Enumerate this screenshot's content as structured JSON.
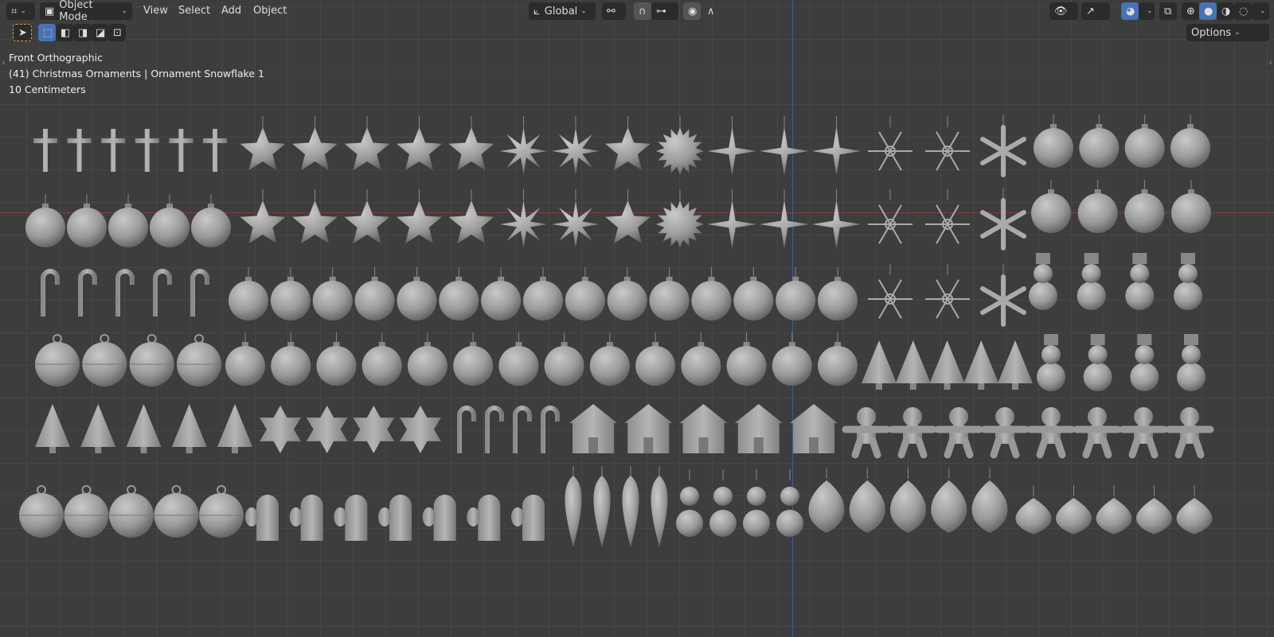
{
  "header": {
    "editor_type": "3D Viewport",
    "mode": "Object Mode",
    "menus": [
      "View",
      "Select",
      "Add",
      "Object"
    ],
    "orientation": "Global",
    "options": "Options"
  },
  "overlay": {
    "view": "Front Orthographic",
    "collection": "(41) Christmas Ornaments | Ornament Snowflake 1",
    "scale": "10 Centimeters"
  },
  "colors": {
    "accent": "#4772b3",
    "x_axis": "#8a3b3b",
    "z_axis": "#3d5a9a",
    "tool_active": "#e8a33c"
  }
}
